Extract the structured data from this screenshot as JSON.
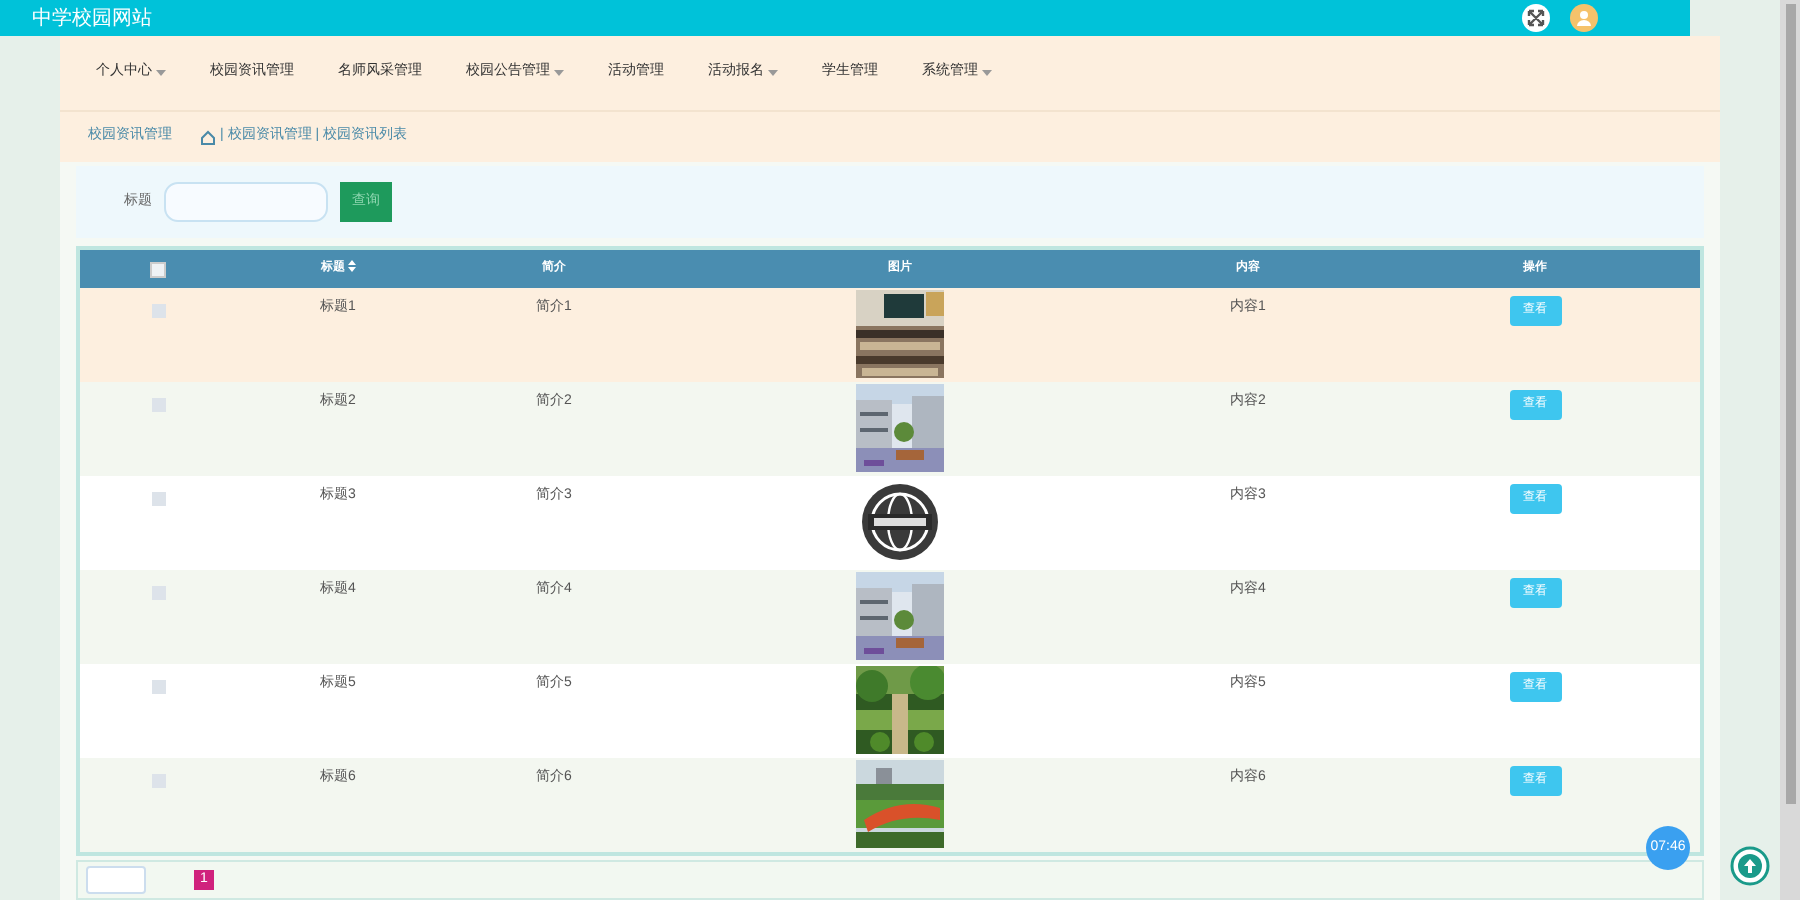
{
  "header": {
    "title": "中学校园网站"
  },
  "nav": [
    {
      "label": "个人中心",
      "dropdown": true
    },
    {
      "label": "校园资讯管理",
      "dropdown": false
    },
    {
      "label": "名师风采管理",
      "dropdown": false
    },
    {
      "label": "校园公告管理",
      "dropdown": true
    },
    {
      "label": "活动管理",
      "dropdown": false
    },
    {
      "label": "活动报名",
      "dropdown": true
    },
    {
      "label": "学生管理",
      "dropdown": false
    },
    {
      "label": "系统管理",
      "dropdown": true
    }
  ],
  "breadcrumb": {
    "section": "校园资讯管理",
    "trail": "| 校园资讯管理 | 校园资讯列表"
  },
  "search": {
    "label": "标题",
    "button": "查询"
  },
  "table": {
    "select_all_checked": false,
    "columns": [
      "标题",
      "简介",
      "图片",
      "内容",
      "操作"
    ],
    "rows": [
      {
        "title": "标题1",
        "summary": "简介1",
        "content": "内容1",
        "action": "查看",
        "hovered": true,
        "checked": false
      },
      {
        "title": "标题2",
        "summary": "简介2",
        "content": "内容2",
        "action": "查看",
        "hovered": false,
        "checked": false
      },
      {
        "title": "标题3",
        "summary": "简介3",
        "content": "内容3",
        "action": "查看",
        "hovered": false,
        "checked": false
      },
      {
        "title": "标题4",
        "summary": "简介4",
        "content": "内容4",
        "action": "查看",
        "hovered": false,
        "checked": false
      },
      {
        "title": "标题5",
        "summary": "简介5",
        "content": "内容5",
        "action": "查看",
        "hovered": false,
        "checked": false
      },
      {
        "title": "标题6",
        "summary": "简介6",
        "content": "内容6",
        "action": "查看",
        "hovered": false,
        "checked": false
      }
    ]
  },
  "pagination": {
    "current": "1"
  },
  "clock_badge": "07:46"
}
